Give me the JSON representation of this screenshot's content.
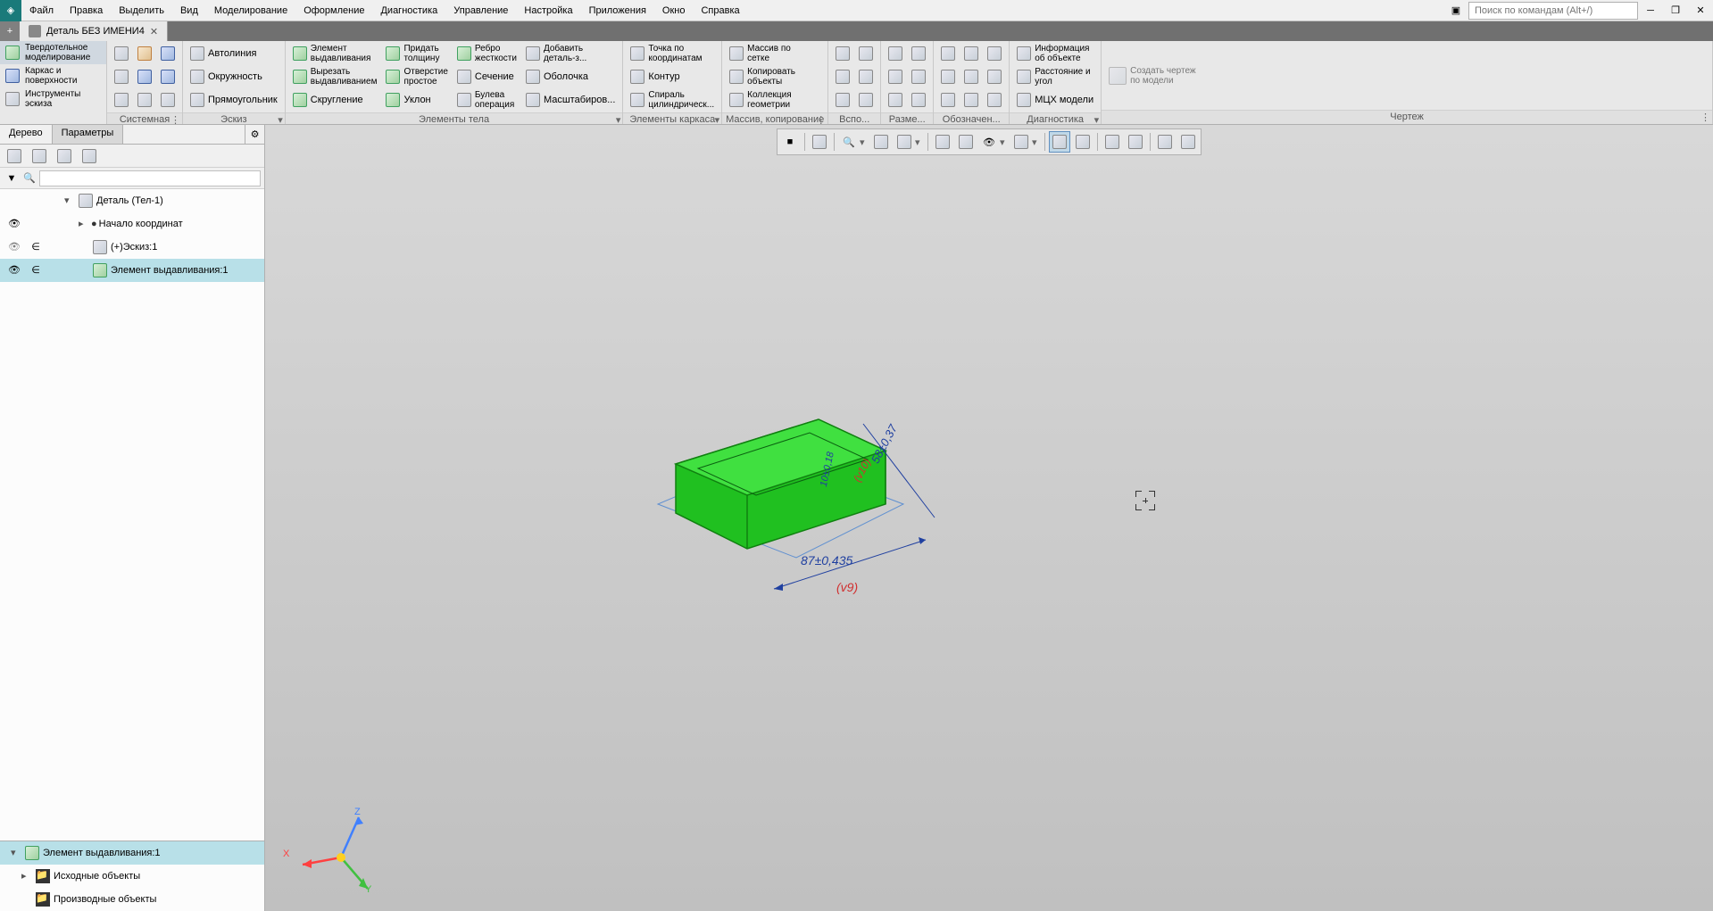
{
  "menu": {
    "items": [
      "Файл",
      "Правка",
      "Выделить",
      "Вид",
      "Моделирование",
      "Оформление",
      "Диагностика",
      "Управление",
      "Настройка",
      "Приложения",
      "Окно",
      "Справка"
    ],
    "search_placeholder": "Поиск по командам (Alt+/)"
  },
  "tab": {
    "title": "Деталь БЕЗ ИМЕНИ4"
  },
  "modes": [
    {
      "label": "Твердотельное\nмоделирование",
      "active": true
    },
    {
      "label": "Каркас и\nповерхности",
      "active": false
    },
    {
      "label": "Инструменты\nэскиза",
      "active": false
    }
  ],
  "ribbon": {
    "section_labels": [
      "Системная",
      "Эскиз",
      "Элементы тела",
      "Элементы каркаса",
      "Массив, копирование",
      "Вспо...",
      "Разме...",
      "Обозначен...",
      "Диагностика",
      "Чертеж"
    ],
    "sketch": {
      "autoline": "Автолиния",
      "circle": "Окружность",
      "rect": "Прямоугольник"
    },
    "body": {
      "extrude": "Элемент\nвыдавливания",
      "cut": "Вырезать\nвыдавливанием",
      "fillet": "Скругление",
      "thickness": "Придать\nтолщину",
      "hole": "Отверстие\nпростое",
      "draft": "Уклон",
      "rib": "Ребро\nжесткости",
      "section": "Сечение",
      "boolean": "Булева\nоперация",
      "add": "Добавить\nдеталь-з...",
      "shell": "Оболочка",
      "scale": "Масштабиров..."
    },
    "wire": {
      "point": "Точка по\nкоординатам",
      "contour": "Контур",
      "helix": "Спираль\nцилиндрическ..."
    },
    "array": {
      "grid": "Массив по\nсетке",
      "copy": "Копировать\nобъекты",
      "collection": "Коллекция\nгеометрии"
    },
    "diag": {
      "info": "Информация\nоб объекте",
      "dist": "Расстояние и\nугол",
      "mcx": "МЦХ модели"
    },
    "drawing": {
      "create": "Создать чертеж\nпо модели"
    }
  },
  "panel": {
    "tabs": [
      "Дерево",
      "Параметры"
    ],
    "tree": [
      {
        "level": 2,
        "label": "Деталь (Тел-1)",
        "expanded": true,
        "vis": false,
        "inc": false
      },
      {
        "level": 3,
        "label": "Начало координат",
        "expanded": false,
        "vis": true,
        "inc": false,
        "bullet": true
      },
      {
        "level": 3,
        "label": "(+)Эскиз:1",
        "vis": "hidden",
        "inc": true
      },
      {
        "level": 3,
        "label": "Элемент выдавливания:1",
        "vis": true,
        "inc": true,
        "selected": true
      }
    ],
    "bottom": [
      {
        "level": 0,
        "label": "Элемент выдавливания:1",
        "expanded": true,
        "selected": true
      },
      {
        "level": 1,
        "label": "Исходные объекты",
        "expanded": false,
        "folder": true
      },
      {
        "level": 1,
        "label": "Производные объекты",
        "folder": true
      }
    ]
  },
  "dimensions": {
    "d1": "87±0,435",
    "d2": "58±0,37",
    "d3": "(v9)",
    "d4": "(v10)",
    "d5": "10±0,18"
  },
  "axes": {
    "x": "X",
    "y": "Y",
    "z": "Z"
  }
}
